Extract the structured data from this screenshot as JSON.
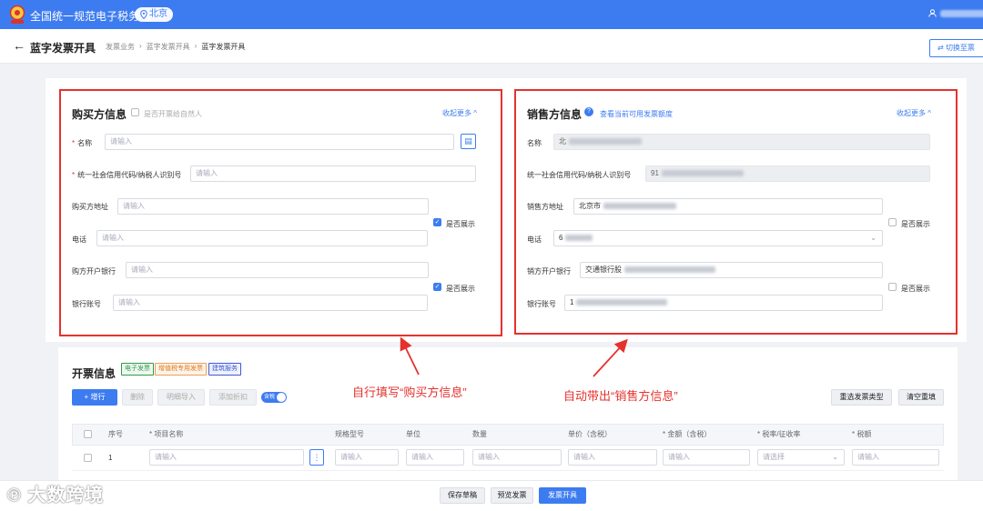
{
  "app": {
    "title": "全国统一规范电子税务局",
    "location": "北京",
    "location_icon": "pin-icon",
    "user_icon": "user-icon"
  },
  "page": {
    "title": "蓝字发票开具",
    "breadcrumb": [
      "发票业务",
      "蓝字发票开具",
      "蓝字发票开具"
    ],
    "switch_label": "切换至票"
  },
  "buyer": {
    "title": "购买方信息",
    "natural_person_label": "是否开票给自然人",
    "collapse_label": "收起更多 ^",
    "fields": {
      "name_label": "名称",
      "tax_id_label": "统一社会信用代码/纳税人识别号",
      "address_label": "购买方地址",
      "phone_label": "电话",
      "bank_label": "购方开户银行",
      "account_label": "银行账号",
      "placeholder": "请输入"
    },
    "show_label": "是否展示"
  },
  "seller": {
    "title": "销售方信息",
    "quota_link": "查看当前可用发票额度",
    "collapse_label": "收起更多 ^",
    "fields": {
      "name_label": "名称",
      "name_value": "北",
      "tax_id_label": "统一社会信用代码/纳税人识别号",
      "tax_id_value": "91",
      "address_label": "销售方地址",
      "address_value": "北京市",
      "phone_label": "电话",
      "phone_value": "6",
      "bank_label": "销方开户银行",
      "bank_value": "交通银行股",
      "account_label": "银行账号",
      "account_value": "1"
    },
    "show_label": "是否展示"
  },
  "invoice": {
    "title": "开票信息",
    "tags": [
      "电子发票",
      "增值税专用发票",
      "建筑服务"
    ],
    "buttons": {
      "add_row": "+ 增行",
      "delete": "删除",
      "import": "明细导入",
      "discount": "添加折扣",
      "tax_toggle": "含税",
      "reselect": "重选发票类型",
      "clear": "清空重填"
    },
    "columns": [
      "序号",
      "* 项目名称",
      "规格型号",
      "单位",
      "数量",
      "单价（含税）",
      "* 金额（含税）",
      "* 税率/征收率",
      "* 税额"
    ],
    "row": {
      "index": "1",
      "placeholder": "请输入",
      "rate_placeholder": "请选择"
    }
  },
  "annotations": {
    "buyer_note": "自行填写“购买方信息”",
    "seller_note": "自动带出“销售方信息”"
  },
  "footer": {
    "save_draft": "保存草稿",
    "preview": "预览发票",
    "issue": "发票开具"
  },
  "watermark": "大数跨境"
}
